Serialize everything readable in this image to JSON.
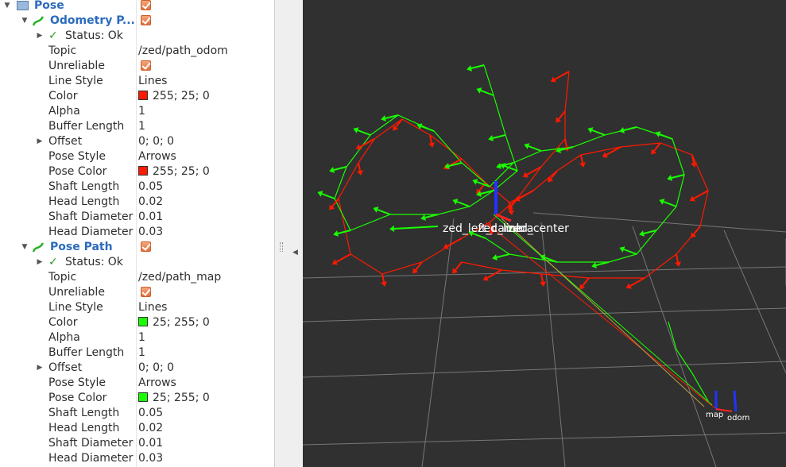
{
  "tree": {
    "pose": {
      "label": "Pose"
    },
    "odometry": {
      "label": "Odometry P...",
      "status": "Status: Ok",
      "props": [
        {
          "name": "Topic",
          "value": "/zed/path_odom"
        },
        {
          "name": "Unreliable",
          "value": ""
        },
        {
          "name": "Line Style",
          "value": "Lines"
        },
        {
          "name": "Color",
          "value": "255; 25; 0"
        },
        {
          "name": "Alpha",
          "value": "1"
        },
        {
          "name": "Buffer Length",
          "value": "1"
        },
        {
          "name": "Offset",
          "value": "0; 0; 0"
        },
        {
          "name": "Pose Style",
          "value": "Arrows"
        },
        {
          "name": "Pose Color",
          "value": "255; 25; 0"
        },
        {
          "name": "Shaft Length",
          "value": "0.05"
        },
        {
          "name": "Head Length",
          "value": "0.02"
        },
        {
          "name": "Shaft Diameter",
          "value": "0.01"
        },
        {
          "name": "Head Diameter",
          "value": "0.03"
        }
      ]
    },
    "posepath": {
      "label": "Pose Path",
      "status": "Status: Ok",
      "props": [
        {
          "name": "Topic",
          "value": "/zed/path_map"
        },
        {
          "name": "Unreliable",
          "value": ""
        },
        {
          "name": "Line Style",
          "value": "Lines"
        },
        {
          "name": "Color",
          "value": "25; 255; 0"
        },
        {
          "name": "Alpha",
          "value": "1"
        },
        {
          "name": "Buffer Length",
          "value": "1"
        },
        {
          "name": "Offset",
          "value": "0; 0; 0"
        },
        {
          "name": "Pose Style",
          "value": "Arrows"
        },
        {
          "name": "Pose Color",
          "value": "25; 255; 0"
        },
        {
          "name": "Shaft Length",
          "value": "0.05"
        },
        {
          "name": "Head Length",
          "value": "0.02"
        },
        {
          "name": "Shaft Diameter",
          "value": "0.01"
        },
        {
          "name": "Head Diameter",
          "value": "0.03"
        }
      ]
    }
  },
  "colors": {
    "odom": "#ff1900",
    "map": "#19ff00",
    "grid": "#777777",
    "background": "#303030"
  },
  "viewport": {
    "frame_label_center": "zed_center",
    "frame_label_overlap": "zed_left_camera",
    "frame_label_overlap_2": "zed_link",
    "frame_label_map": "map",
    "frame_label_odom": "odom"
  }
}
